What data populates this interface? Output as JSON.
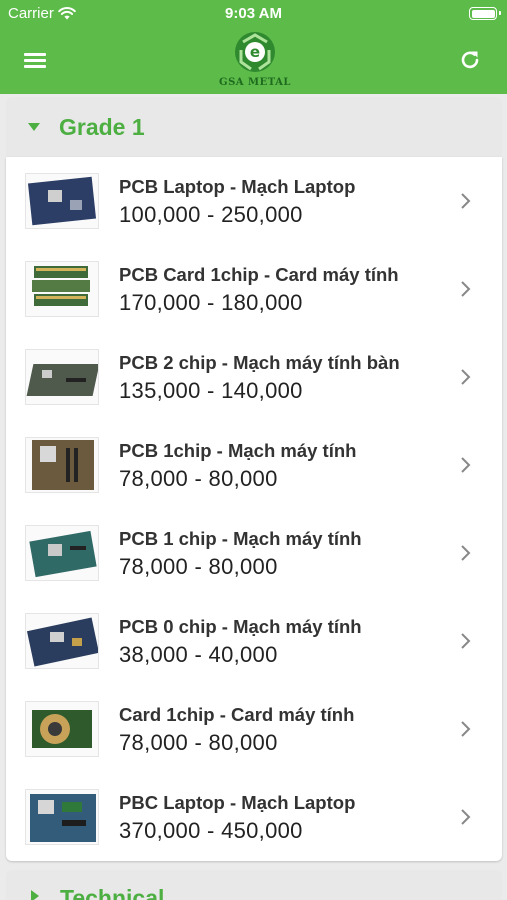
{
  "status_bar": {
    "carrier": "Carrier",
    "time": "9:03 AM"
  },
  "header": {
    "logo_text": "GSA METAL"
  },
  "colors": {
    "brand_green": "#5dbb4a",
    "accent_green": "#4daf42",
    "logo_dark_green": "#1e6b1e"
  },
  "icons": {
    "menu": "hamburger-menu-icon",
    "refresh": "refresh-icon",
    "chevron": "chevron-right-icon",
    "expand": "caret-down-icon",
    "collapse": "caret-right-icon"
  },
  "sections": [
    {
      "title": "Grade 1",
      "expanded": true,
      "items": [
        {
          "name": "PCB Laptop - Mạch Laptop",
          "price": "100,000 - 250,000"
        },
        {
          "name": "PCB Card 1chip - Card máy tính",
          "price": "170,000 - 180,000"
        },
        {
          "name": "PCB 2 chip - Mạch  máy tính bàn",
          "price": "135,000 - 140,000"
        },
        {
          "name": "PCB 1chip - Mạch máy tính",
          "price": "78,000 - 80,000"
        },
        {
          "name": "PCB 1 chip - Mạch máy tính",
          "price": "78,000 - 80,000"
        },
        {
          "name": "PCB 0 chip - Mạch  máy tính",
          "price": "38,000 - 40,000"
        },
        {
          "name": "Card 1chip - Card máy tính",
          "price": "78,000 - 80,000"
        },
        {
          "name": "PBC Laptop - Mạch Laptop",
          "price": "370,000 - 450,000"
        }
      ]
    },
    {
      "title": "Technical",
      "expanded": false
    }
  ]
}
